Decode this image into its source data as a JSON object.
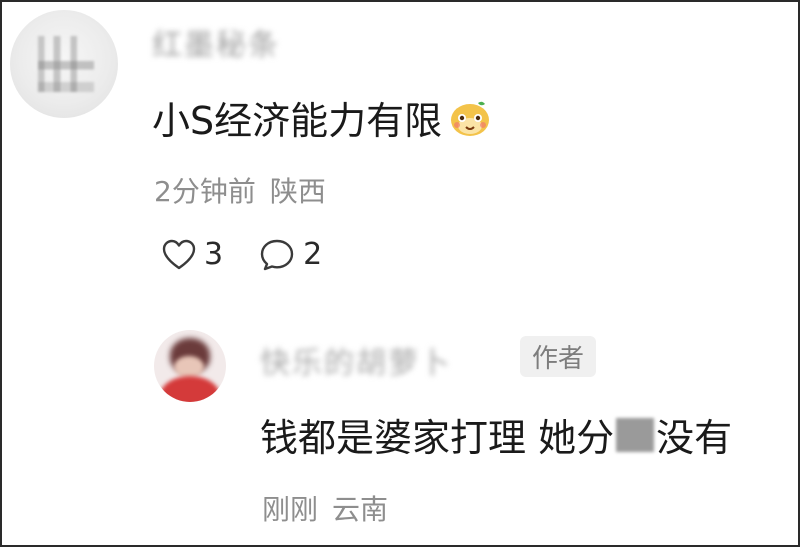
{
  "main_comment": {
    "username": "红墨秘条",
    "text": "小S经济能力有限",
    "emoji": "smiling-face-emoji",
    "time": "2分钟前",
    "location": "陕西",
    "likes": "3",
    "replies": "2"
  },
  "reply": {
    "username": "快乐的胡萝卜",
    "badge": "作者",
    "text_before": "钱都是婆家打理 她分",
    "text_after": "没有",
    "time": "刚刚",
    "location": "云南"
  },
  "colors": {
    "text_primary": "#1a1a1a",
    "text_meta": "#8e8e8e",
    "badge_bg": "#f0f0f0",
    "frame_border": "#2a2a2a"
  },
  "icons": {
    "like": "heart-outline-icon",
    "reply": "speech-bubble-icon"
  }
}
